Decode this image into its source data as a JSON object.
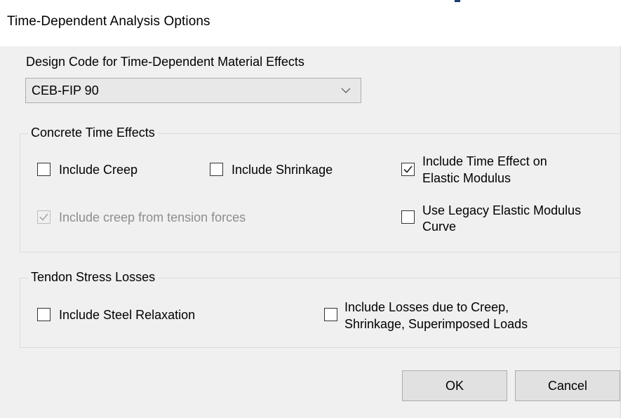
{
  "window": {
    "title": "Time-Dependent Analysis Options"
  },
  "design_code": {
    "label": "Design Code for Time-Dependent Material Effects",
    "selected": "CEB-FIP 90"
  },
  "concrete_group": {
    "label": "Concrete Time Effects",
    "include_creep": {
      "label": "Include Creep",
      "checked": false
    },
    "include_shrinkage": {
      "label": "Include Shrinkage",
      "checked": false
    },
    "include_time_effect": {
      "line1": "Include Time Effect on",
      "line2": "Elastic Modulus",
      "checked": true
    },
    "creep_tension": {
      "label": "Include creep from tension forces",
      "checked": true,
      "enabled": false
    },
    "legacy_modulus": {
      "line1": "Use Legacy Elastic Modulus",
      "line2": "Curve",
      "checked": false
    }
  },
  "tendon_group": {
    "label": "Tendon Stress Losses",
    "steel_relaxation": {
      "label": "Include Steel Relaxation",
      "checked": false
    },
    "losses": {
      "line1": "Include Losses due to Creep,",
      "line2": "Shrinkage, Superimposed Loads",
      "checked": false
    }
  },
  "buttons": {
    "ok": "OK",
    "cancel": "Cancel"
  }
}
